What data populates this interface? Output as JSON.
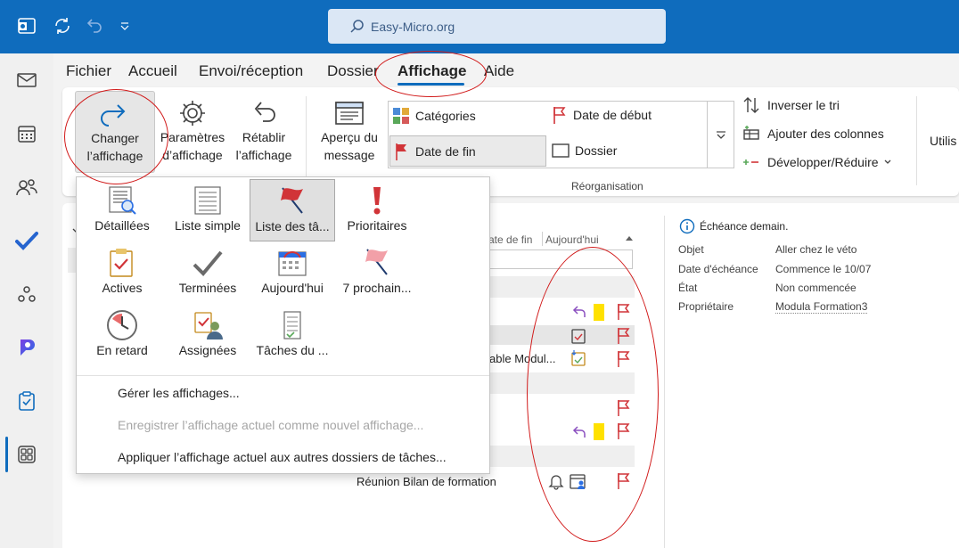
{
  "titlebar": {
    "search_placeholder": "Easy-Micro.org"
  },
  "menu": {
    "items": [
      "Fichier",
      "Accueil",
      "Envoi/réception",
      "Dossier",
      "Affichage",
      "Aide"
    ]
  },
  "ribbon": {
    "change_view": "Changer\nl’affichage",
    "view_settings": "Paramètres\nd’affichage",
    "reset_view": "Rétablir\nl’affichage",
    "message_preview": "Aperçu du\nmessage",
    "gallery": {
      "categories": "Catégories",
      "start_date": "Date de début",
      "due_date": "Date de fin",
      "folder": "Dossier"
    },
    "reverse_sort": "Inverser le tri",
    "add_columns": "Ajouter des colonnes",
    "expand_collapse": "Développer/Réduire",
    "group_label": "Réorganisation",
    "cut_off": "Utilis"
  },
  "dropdown": {
    "tiles": [
      {
        "label": "Détaillées"
      },
      {
        "label": "Liste simple"
      },
      {
        "label": "Liste des tâ..."
      },
      {
        "label": "Prioritaires"
      },
      {
        "label": "Actives"
      },
      {
        "label": "Terminées"
      },
      {
        "label": "Aujourd'hui"
      },
      {
        "label": "7 prochain..."
      },
      {
        "label": "En retard"
      },
      {
        "label": "Assignées"
      },
      {
        "label": "Tâches du ..."
      }
    ],
    "commands": {
      "manage": "Gérer les affichages...",
      "save": "Enregistrer l’affichage actuel comme nouvel affichage...",
      "apply": "Appliquer l’affichage actuel aux autres dossiers de tâches..."
    }
  },
  "tasklist": {
    "col_due": "ate de fin",
    "col_today": "Aujourd'hui",
    "partial_text": "able Modul...",
    "task_title": "Réunion Bilan de formation"
  },
  "details": {
    "notice": "Échéance demain.",
    "labels": {
      "subject": "Objet",
      "due": "Date d'échéance",
      "status": "État",
      "owner": "Propriétaire"
    },
    "values": {
      "subject": "Aller chez le véto",
      "due": "Commence le 10/07",
      "status": "Non commencée",
      "owner": "Modula Formation3"
    }
  },
  "colors": {
    "accent": "#0f6cbd",
    "flag": "#d13438",
    "annotation": "#d11a1a"
  }
}
